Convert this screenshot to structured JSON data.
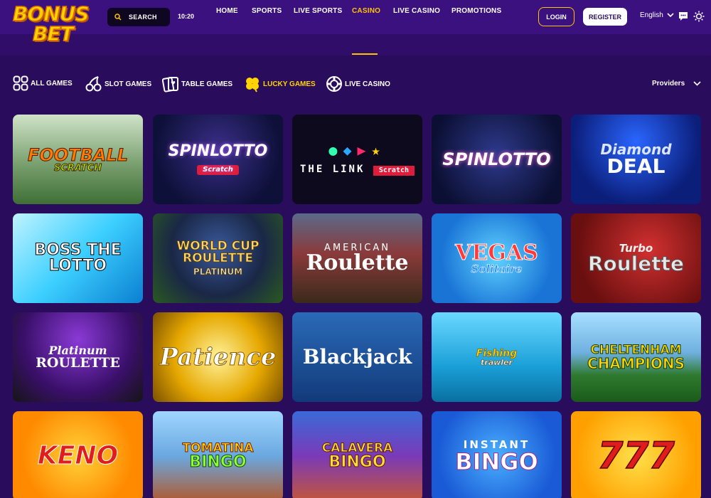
{
  "brand": {
    "line1": "BONUS",
    "line2": "BET"
  },
  "header": {
    "search_label": "SEARCH",
    "clock": "10:20",
    "login_label": "LOGIN",
    "register_label": "REGISTER",
    "language": "English"
  },
  "nav": {
    "items": [
      {
        "label": "HOME"
      },
      {
        "label": "SPORTS"
      },
      {
        "label": "LIVE SPORTS"
      },
      {
        "label": "CASINO",
        "active": true
      },
      {
        "label": "LIVE CASINO"
      },
      {
        "label": "PROMOTIONS"
      }
    ]
  },
  "categories": {
    "items": [
      {
        "label": "ALL GAMES",
        "icon": "grid-icon"
      },
      {
        "label": "SLOT GAMES",
        "icon": "cherries-icon"
      },
      {
        "label": "TABLE GAMES",
        "icon": "cards-icon"
      },
      {
        "label": "LUCKY GAMES",
        "icon": "clover-icon",
        "active": true
      },
      {
        "label": "LIVE CASINO",
        "icon": "chip-icon"
      }
    ],
    "providers_label": "Providers"
  },
  "games": [
    {
      "title": "FOOTBALL",
      "sub": "SCRATCH"
    },
    {
      "title": "SPINLOTTO",
      "sub": "Scratch"
    },
    {
      "title": "THE LINK",
      "sub": "Scratch"
    },
    {
      "title": "SPINLOTTO",
      "sub": ""
    },
    {
      "title": "Diamond",
      "sub": "DEAL"
    },
    {
      "title": "BOSS THE LOTTO",
      "sub": ""
    },
    {
      "title": "WORLD CUP ROULETTE",
      "sub": "PLATINUM"
    },
    {
      "title": "AMERICAN",
      "sub": "Roulette"
    },
    {
      "title": "VEGAS",
      "sub": "Solitaire"
    },
    {
      "title": "Turbo",
      "sub": "Roulette"
    },
    {
      "title": "Platinum",
      "sub": "ROULETTE"
    },
    {
      "title": "Patience",
      "sub": ""
    },
    {
      "title": "Blackjack",
      "sub": ""
    },
    {
      "title": "Fishing",
      "sub": "trawler"
    },
    {
      "title": "CHELTENHAM",
      "sub": "CHAMPIONS"
    },
    {
      "title": "KENO",
      "sub": ""
    },
    {
      "title": "TOMATINA",
      "sub": "BINGO"
    },
    {
      "title": "CALAVERA",
      "sub": "BINGO"
    },
    {
      "title": "INSTANT",
      "sub": "BINGO"
    },
    {
      "title": "777",
      "sub": ""
    }
  ]
}
